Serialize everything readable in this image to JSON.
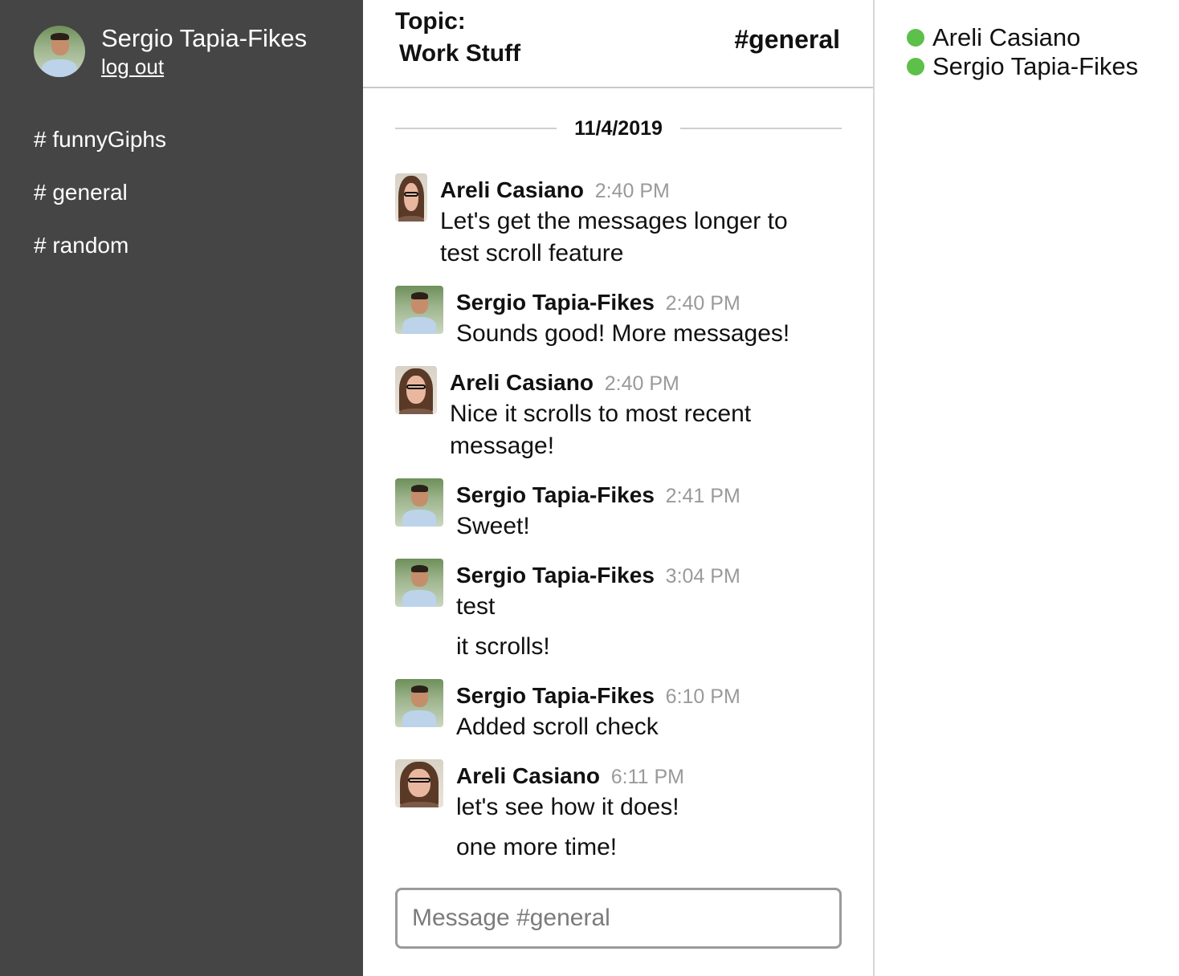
{
  "colors": {
    "sidebar_bg": "#454545",
    "online": "#5cc04a",
    "timestamp": "#9a9a9a"
  },
  "sidebar": {
    "user_name": "Sergio Tapia-Fikes",
    "logout_label": "log out",
    "channels": [
      {
        "label": "# funnyGiphs"
      },
      {
        "label": "# general"
      },
      {
        "label": "# random"
      }
    ]
  },
  "header": {
    "topic_label": "Topic:",
    "topic_value": "Work Stuff",
    "channel": "#general"
  },
  "date_divider": "11/4/2019",
  "messages": [
    {
      "author": "Areli Casiano",
      "time": "2:40 PM",
      "avatar": "areli-avatar",
      "lines": [
        "Let's get the messages longer to test scroll feature"
      ]
    },
    {
      "author": "Sergio Tapia-Fikes",
      "time": "2:40 PM",
      "avatar": "sergio-avatar",
      "lines": [
        "Sounds good! More messages!"
      ]
    },
    {
      "author": "Areli Casiano",
      "time": "2:40 PM",
      "avatar": "areli-avatar",
      "lines": [
        "Nice it scrolls to most recent message!"
      ]
    },
    {
      "author": "Sergio Tapia-Fikes",
      "time": "2:41 PM",
      "avatar": "sergio-avatar",
      "lines": [
        "Sweet!"
      ]
    },
    {
      "author": "Sergio Tapia-Fikes",
      "time": "3:04 PM",
      "avatar": "sergio-avatar",
      "lines": [
        "test",
        "it scrolls!"
      ]
    },
    {
      "author": "Sergio Tapia-Fikes",
      "time": "6:10 PM",
      "avatar": "sergio-avatar",
      "lines": [
        "Added scroll check"
      ]
    },
    {
      "author": "Areli Casiano",
      "time": "6:11 PM",
      "avatar": "areli-avatar",
      "lines": [
        "let's see how it does!",
        "one more time!"
      ]
    }
  ],
  "composer": {
    "placeholder": "Message #general"
  },
  "members": [
    {
      "name": "Areli Casiano",
      "status": "online"
    },
    {
      "name": "Sergio Tapia-Fikes",
      "status": "online"
    }
  ]
}
